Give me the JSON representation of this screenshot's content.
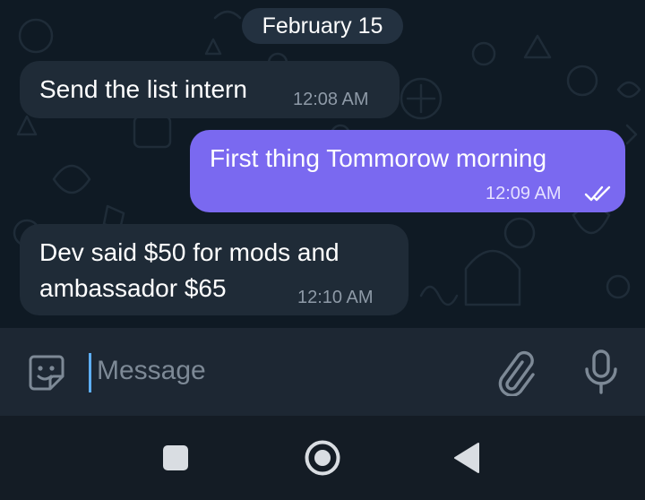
{
  "chat": {
    "date_separator": "February 15",
    "messages": [
      {
        "direction": "incoming",
        "text": "Send the list intern",
        "time": "12:08 AM"
      },
      {
        "direction": "outgoing",
        "text": "First thing Tommorow morning",
        "time": "12:09 AM",
        "status": "read"
      },
      {
        "direction": "incoming",
        "lines": [
          "Dev said $50 for mods and",
          "ambassador $65"
        ],
        "time": "12:10 AM"
      }
    ]
  },
  "composer": {
    "placeholder": "Message",
    "icons": {
      "left": "sticker-icon",
      "attach": "paperclip-icon",
      "voice": "microphone-icon"
    }
  },
  "navigation_bar": {
    "buttons": [
      "recents-square-icon",
      "home-circle-icon",
      "back-triangle-icon"
    ]
  },
  "colors": {
    "chat_background": "#0f1a24",
    "incoming_bubble": "#1f2b37",
    "outgoing_bubble": "#7a69f0",
    "composer_background": "#1d2733",
    "navbar_background": "#141c25",
    "caret": "#5eaef5"
  }
}
